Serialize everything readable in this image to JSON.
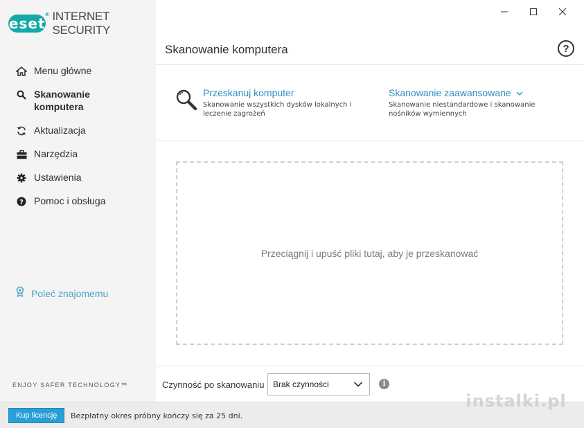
{
  "app": {
    "brand_badge": "eset",
    "brand_reg": "®",
    "product": "INTERNET SECURITY",
    "tagline": "ENJOY SAFER TECHNOLOGY™"
  },
  "window": {
    "minimize": "—",
    "maximize": "☐",
    "close": "✕"
  },
  "sidebar": {
    "items": [
      {
        "label": "Menu główne",
        "icon": "home-icon"
      },
      {
        "label": "Skanowanie komputera",
        "icon": "search-icon",
        "active": true
      },
      {
        "label": "Aktualizacja",
        "icon": "refresh-icon"
      },
      {
        "label": "Narzędzia",
        "icon": "toolbox-icon"
      },
      {
        "label": "Ustawienia",
        "icon": "gear-icon"
      },
      {
        "label": "Pomoc i obsługa",
        "icon": "question-circle-icon"
      }
    ],
    "refer": {
      "label": "Poleć znajomemu",
      "icon": "gift-icon"
    }
  },
  "main": {
    "title": "Skanowanie komputera",
    "help": "?",
    "scan_options": [
      {
        "title": "Przeskanuj komputer",
        "desc_line1": "Skanowanie wszystkich dysków lokalnych i",
        "desc_line2": "leczenie zagrożeń"
      },
      {
        "title": "Skanowanie zaawansowane",
        "desc_line1": "Skanowanie niestandardowe i skanowanie",
        "desc_line2": "nośników wymiennych"
      }
    ],
    "dropzone_text": "Przeciągnij i upuść pliki tutaj, aby je przeskanować",
    "after_scan": {
      "label": "Czynność po skanowaniu",
      "selected": "Brak czynności",
      "info": "i"
    }
  },
  "footer": {
    "buy_label": "Kup licencję",
    "trial_text": "Bezpłatny okres próbny kończy się za 25 dni."
  },
  "watermark": "instalki.pl",
  "colors": {
    "accent": "#2d8ec0",
    "brand": "#14a8a8",
    "buy": "#2a9fd6"
  }
}
